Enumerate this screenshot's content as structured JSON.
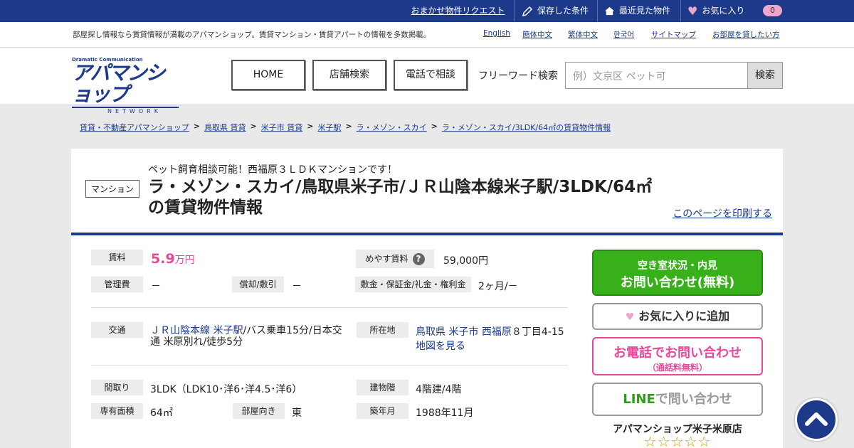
{
  "topbar": {
    "request": "おまかせ物件リクエスト",
    "saved": "保存した条件",
    "recent": "最近見た物件",
    "favorite": "お気に入り",
    "fav_count": "0"
  },
  "subbar": {
    "tagline": "部屋探し情報なら賃貸情報が満載のアパマンショップ。賃貸マンション・賃貸アパートの情報を多数掲載。",
    "links": [
      "English",
      "簡体中文",
      "繁体中文",
      "한국어",
      "サイトマップ",
      "お部屋を貸したい方"
    ]
  },
  "header": {
    "logo_small": "Dramatic Communication",
    "logo_big": "アパマンショップ",
    "logo_net": "NETWORK",
    "nav": [
      "HOME",
      "店舗検索",
      "電話で相談"
    ],
    "freeword_label": "フリーワード検索",
    "search_placeholder": "例）文京区 ペット可",
    "search_button": "検索"
  },
  "breadcrumb": [
    "賃貸・不動産アパマンショップ",
    "鳥取県 賃貸",
    "米子市 賃貸",
    "米子駅",
    "ラ・メゾン・スカイ",
    "ラ・メゾン・スカイ/3LDK/64㎡の賃貸物件情報"
  ],
  "title": {
    "type": "マンション",
    "catch": "ペット飼育相談可能！西福原３ＬＤＫマンションです！",
    "main": "ラ・メゾン・スカイ/鳥取県米子市/ＪＲ山陰本線米子駅/3LDK/64㎡の賃貸物件情報",
    "print": "このページを印刷する"
  },
  "details": {
    "rent_label": "賃料",
    "rent_value": "5.9",
    "rent_unit": "万円",
    "meyasu_label": "めやす賃料",
    "meyasu_value": "59,000円",
    "kanri_label": "管理費",
    "kanri_value": "－",
    "shokyaku_label": "償却/敷引",
    "shokyaku_value": "－",
    "shikikin_label": "敷金・保証金/礼金・権利金",
    "shikikin_value": "2ヶ月/－",
    "kotsu_label": "交通",
    "kotsu_line": "ＪＲ山陰本線",
    "kotsu_station": "米子駅",
    "kotsu_rest": "/バス乗車15分/日本交通 米原別れ/徒歩5分",
    "address_label": "所在地",
    "addr_pref": "鳥取県",
    "addr_city": "米子市",
    "addr_town": "西福原",
    "addr_rest": "８丁目4-15",
    "map_link": "地図を見る",
    "madori_label": "間取り",
    "madori_value": "3LDK（LDK10･洋6･洋4.5･洋6）",
    "floor_label": "建物階",
    "floor_value": "4階建/4階",
    "area_label": "専有面積",
    "area_value": "64㎡",
    "direction_label": "部屋向き",
    "direction_value": "東",
    "built_label": "築年月",
    "built_value": "1988年11月"
  },
  "actions": {
    "inquiry_l1": "空き室状況・内見",
    "inquiry_l2": "お問い合わせ(無料)",
    "fav_add": "お気に入りに追加",
    "tel_l1": "お電話でお問い合わせ",
    "tel_l2": "（通話料無料）",
    "line_green": "LINE",
    "line_rest": "で問い合わせ",
    "shop_name": "アパマンショップ米子米原店",
    "rating_stars": 0
  }
}
